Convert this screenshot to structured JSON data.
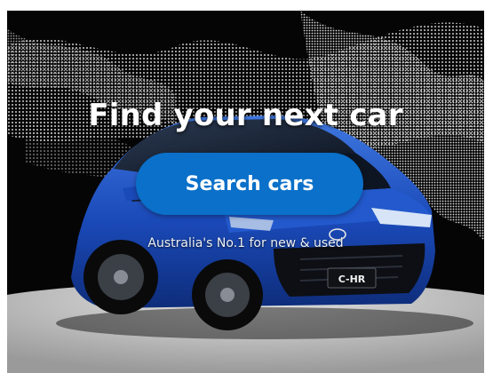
{
  "hero": {
    "title": "Find your next car",
    "search_button_label": "Search cars",
    "tagline": "Australia's No.1 for new & used",
    "car_badge": "C-HR"
  },
  "colors": {
    "background": "#050505",
    "button": "#0a70c9",
    "car_body": "#1a49b8",
    "floor": "#cfcfcf"
  }
}
